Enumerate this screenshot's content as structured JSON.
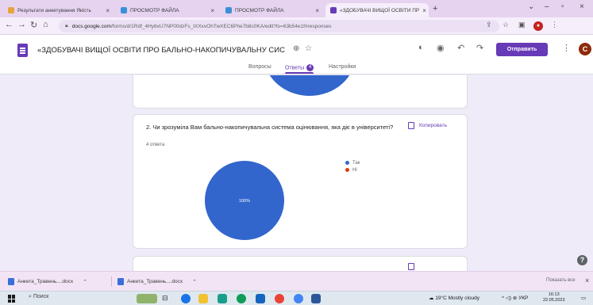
{
  "browser": {
    "tabs": [
      {
        "label": "Результати анкетування Якість",
        "active": false
      },
      {
        "label": "ПРОСМОТР ФАЙЛА",
        "active": false
      },
      {
        "label": "ПРОСМОТР ФАЙЛА",
        "active": false
      },
      {
        "label": "«ЗДОБУВАЧІ ВИЩОЇ ОСВІТИ ПР",
        "active": true
      }
    ],
    "url_host": "docs.google.com",
    "url_path": "/forms/d/1Rdf_4Hy6xU7NP00dzFs_tXXxvOhTwXEC6Phe7b8c0KA/edit?ts=63b54e1f#responses"
  },
  "form": {
    "title": "«ЗДОБУВАЧІ ВИЩОЇ ОСВІТИ ПРО БАЛЬНО-НАКОПИЧУВАЛЬНУ СИС",
    "send_label": "Отправить",
    "avatar_letter": "C",
    "tabs": {
      "questions": "Вопросы",
      "responses": "Ответы",
      "responses_count": "4",
      "settings": "Настройки"
    }
  },
  "question": {
    "title": "2. Чи зрозуміла Вам бально-накопичувальна система оцінювання, яка діє в університеті?",
    "count": "4 ответа",
    "copy_label": "Копировать"
  },
  "chart_data": {
    "type": "pie",
    "labels": [
      "Так",
      "Ні"
    ],
    "values": [
      100,
      0
    ],
    "slice_label": "100%",
    "colors": [
      "#3366cc",
      "#dc3912"
    ]
  },
  "downloads": [
    {
      "name": "Анкета_Травень....docx"
    },
    {
      "name": "Анкета_Травень....docx"
    }
  ],
  "downloads_show_all": "Показать все",
  "taskbar": {
    "search": "Поиск",
    "weather": "19°C Mostly cloudy",
    "lang": "УКР",
    "time": "16:13",
    "date": "22.05.2023"
  }
}
